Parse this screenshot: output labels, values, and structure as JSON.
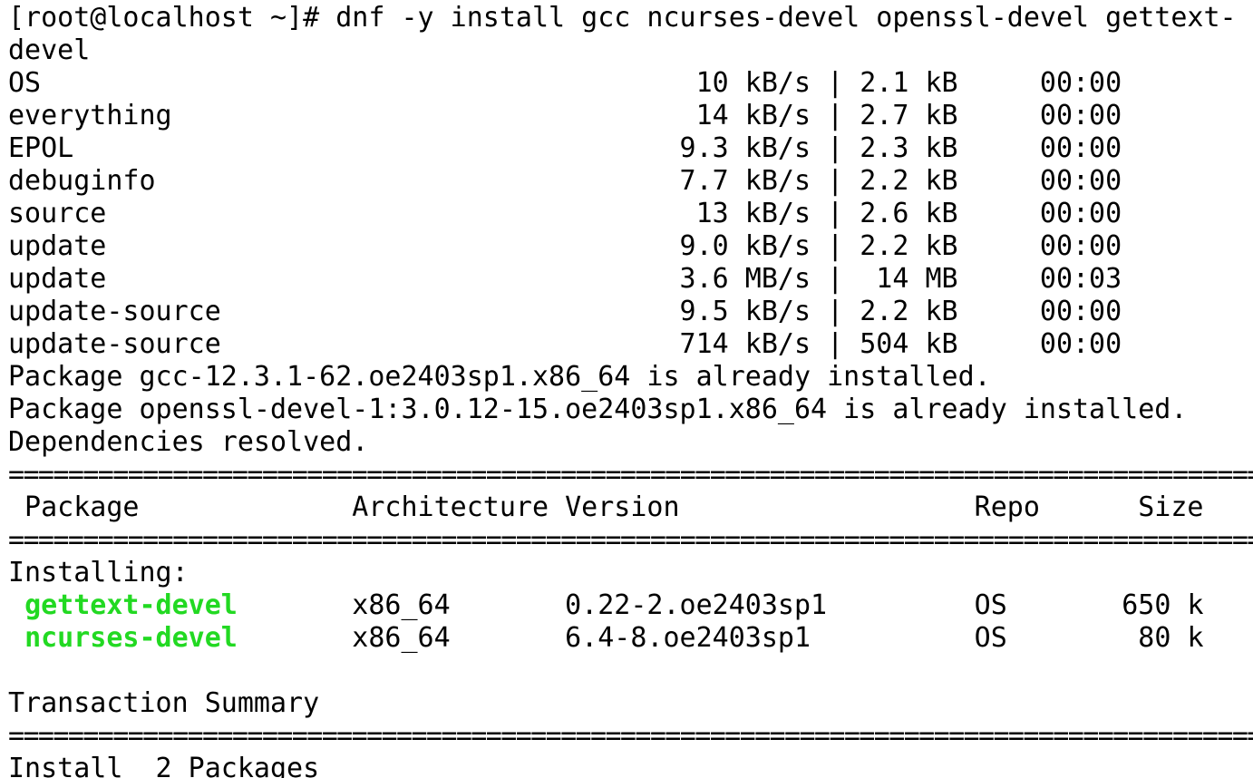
{
  "terminal": {
    "prompt": "[root@localhost ~]# ",
    "command": "dnf -y install gcc ncurses-devel openssl-devel gettext-",
    "command_wrap": "devel",
    "repos": [
      {
        "text": "OS                                        10 kB/s | 2.1 kB     00:00"
      },
      {
        "text": "everything                                14 kB/s | 2.7 kB     00:00"
      },
      {
        "text": "EPOL                                     9.3 kB/s | 2.3 kB     00:00"
      },
      {
        "text": "debuginfo                                7.7 kB/s | 2.2 kB     00:00"
      },
      {
        "text": "source                                    13 kB/s | 2.6 kB     00:00"
      },
      {
        "text": "update                                   9.0 kB/s | 2.2 kB     00:00"
      },
      {
        "text": "update                                   3.6 MB/s |  14 MB     00:03"
      },
      {
        "text": "update-source                            9.5 kB/s | 2.2 kB     00:00"
      },
      {
        "text": "update-source                            714 kB/s | 504 kB     00:00"
      }
    ],
    "msg_gcc": "Package gcc-12.3.1-62.oe2403sp1.x86_64 is already installed.",
    "msg_openssl": "Package openssl-devel-1:3.0.12-15.oe2403sp1.x86_64 is already installed.",
    "msg_deps": "Dependencies resolved.",
    "separator": "========================================================================================",
    "table_header": " Package             Architecture Version                  Repo      Size",
    "installing_label": "Installing:",
    "packages": [
      {
        "name": "gettext-devel",
        "rest": "       x86_64       0.22-2.oe2403sp1         OS       650 k"
      },
      {
        "name": "ncurses-devel",
        "rest": "       x86_64       6.4-8.oe2403sp1          OS        80 k"
      }
    ],
    "summary_label": "Transaction Summary",
    "install_line": "Install  2 Packages",
    "colors": {
      "installed_package": "#22d922",
      "text": "#000000",
      "background": "#ffffff"
    }
  }
}
